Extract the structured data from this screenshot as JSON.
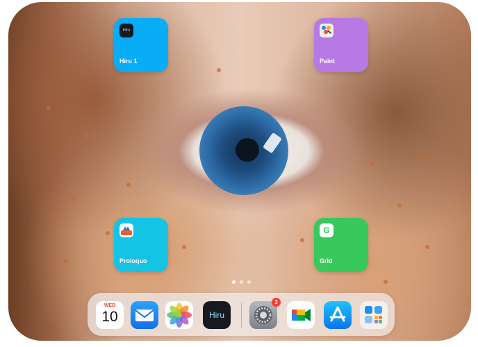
{
  "home": {
    "tiles": [
      {
        "label": "Hiru 1",
        "icon_text": "Hiru",
        "color": "#08adf6"
      },
      {
        "label": "Paint",
        "color": "#b77ae5"
      },
      {
        "label": "Proloquo",
        "color": "#15c3e5"
      },
      {
        "label": "Grid",
        "icon_text": "G",
        "color": "#39c85b"
      }
    ],
    "page_dots": 3,
    "active_page": 1
  },
  "dock": {
    "calendar": {
      "weekday": "WED",
      "day": "10"
    },
    "apps": [
      {
        "name": "Calendar"
      },
      {
        "name": "Mail"
      },
      {
        "name": "Photos"
      },
      {
        "name": "Hiru",
        "icon_text": "Hiru"
      },
      {
        "name": "Settings",
        "badge": "3"
      },
      {
        "name": "Meet"
      },
      {
        "name": "App Store"
      },
      {
        "name": "App Library"
      }
    ]
  }
}
